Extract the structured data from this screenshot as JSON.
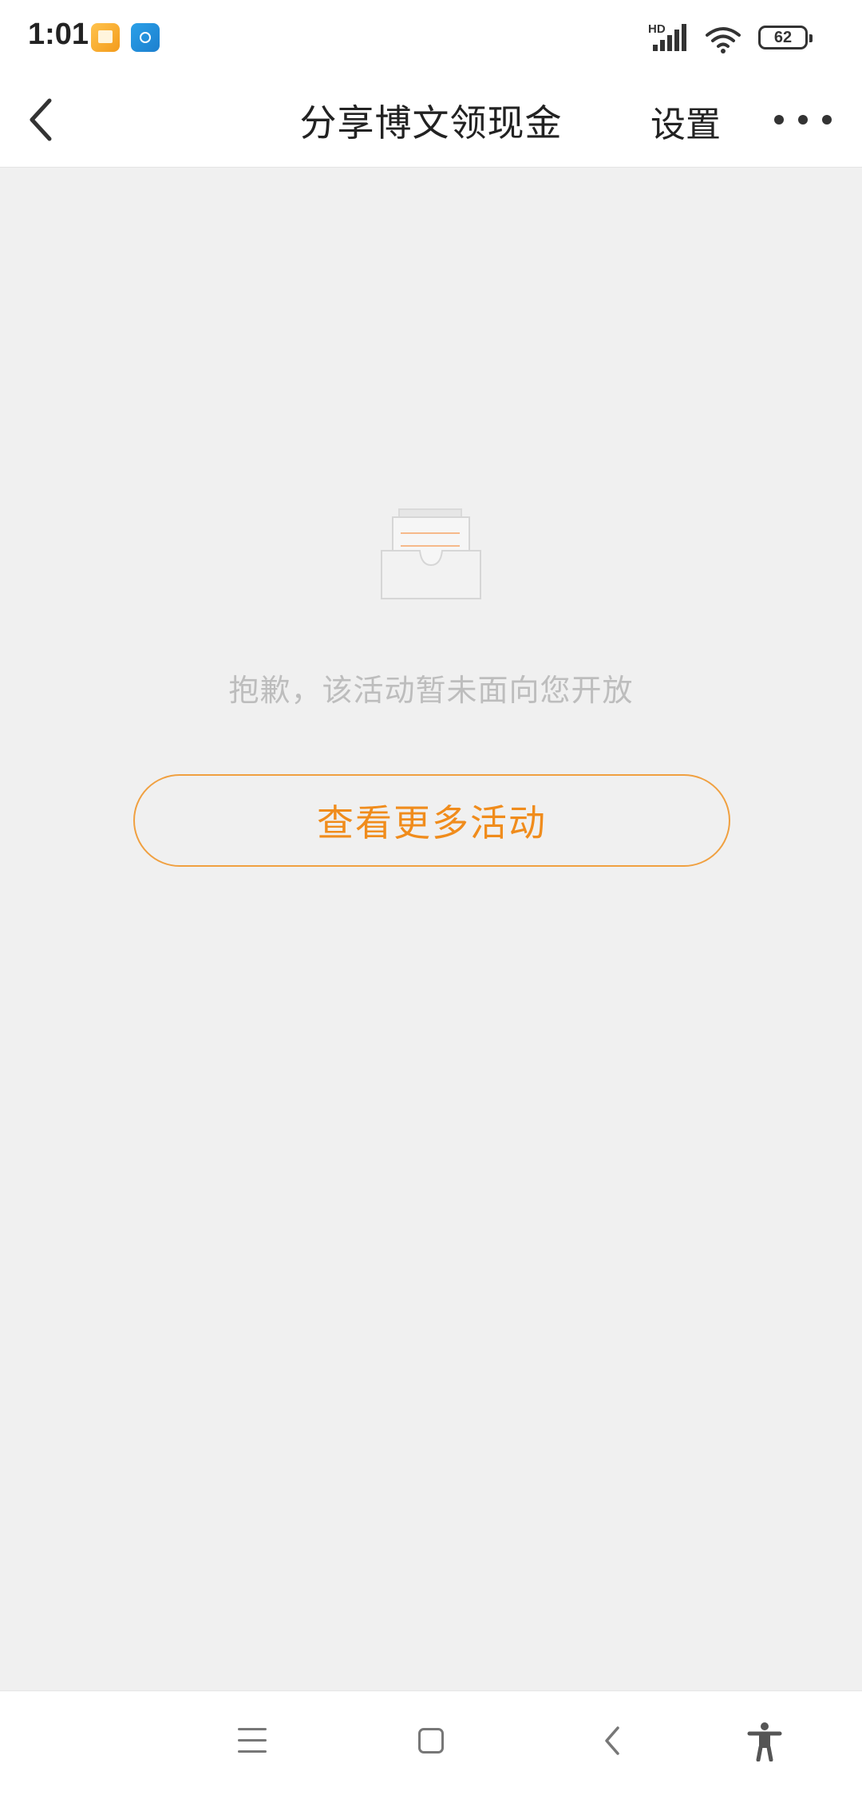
{
  "status_bar": {
    "time": "1:01",
    "network_label": "HD",
    "battery_level": "62",
    "icons": [
      "photo-app-icon",
      "cloud-app-icon",
      "signal-icon",
      "wifi-icon",
      "battery-icon"
    ]
  },
  "nav": {
    "title": "分享博文领现金",
    "settings_label": "设置",
    "icons": [
      "back-arrow-icon",
      "more-dots-icon"
    ]
  },
  "empty_state": {
    "message": "抱歉，该活动暂未面向您开放",
    "button_label": "查看更多活动",
    "illustration": "empty-inbox-icon",
    "accent_color": "#f08c1c",
    "message_color": "#bdbdbd"
  },
  "system_nav": {
    "icons": [
      "menu-icon",
      "home-icon",
      "back-icon",
      "accessibility-icon"
    ]
  }
}
